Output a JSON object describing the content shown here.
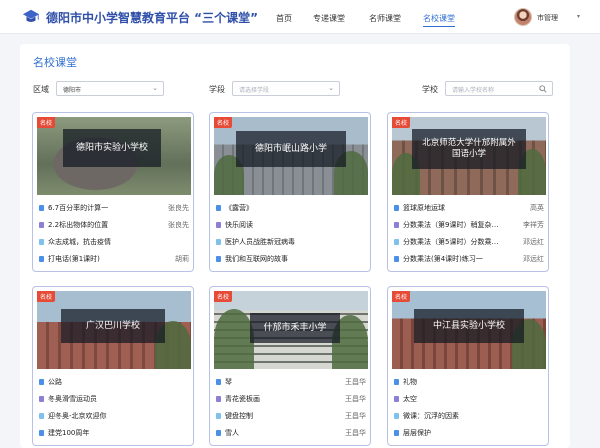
{
  "header": {
    "brand": "德阳市中小学智慧教育平台 “三个课堂”",
    "nav": [
      {
        "label": "首页",
        "active": false
      },
      {
        "label": "专递课堂",
        "active": false
      },
      {
        "label": "名师课堂",
        "active": false
      },
      {
        "label": "名校课堂",
        "active": true
      }
    ],
    "user": "市管理",
    "brand_color": "#2f4fa8",
    "accent_color": "#2f6fd0"
  },
  "page": {
    "title": "名校课堂",
    "filters": {
      "region_label": "区域",
      "region_value": "德阳市",
      "stage_label": "学段",
      "stage_placeholder": "请选择学段",
      "school_label": "学校",
      "school_placeholder": "请输入学校名称"
    }
  },
  "cards": [
    {
      "tag": "名校",
      "school": "德阳市实验小学校",
      "lessons": [
        {
          "title": "6.7百分率的计算一",
          "author": "张良先",
          "bullet": "blue"
        },
        {
          "title": "2.2标出物体的位置",
          "author": "张良先",
          "bullet": "purple"
        },
        {
          "title": "众志成城，抗击疫情",
          "author": "",
          "bullet": "cyan"
        },
        {
          "title": "打电话(第1课时)",
          "author": "胡莉",
          "bullet": "blue"
        }
      ]
    },
    {
      "tag": "名校",
      "school": "德阳市岷山路小学",
      "lessons": [
        {
          "title": "《露营》",
          "author": "",
          "bullet": "blue"
        },
        {
          "title": "快乐阅读",
          "author": "",
          "bullet": "purple"
        },
        {
          "title": "医护人员战胜新冠病毒",
          "author": "",
          "bullet": "cyan"
        },
        {
          "title": "我们和互联网的故事",
          "author": "",
          "bullet": "blue"
        }
      ]
    },
    {
      "tag": "名校",
      "school_line1": "北京师范大学什邡附属外",
      "school_line2": "国语小学",
      "lessons": [
        {
          "title": "篮球原地运球",
          "author": "高英",
          "bullet": "blue"
        },
        {
          "title": "分数乘法（第9课时）稍复杂…",
          "author": "李祥芳",
          "bullet": "purple"
        },
        {
          "title": "分数乘法（第5课时）分数乘…",
          "author": "邓远红",
          "bullet": "cyan"
        },
        {
          "title": "分数乘法(第4课时)练习一",
          "author": "邓远红",
          "bullet": "blue"
        }
      ]
    },
    {
      "tag": "名校",
      "school": "广汉巴川学校",
      "lessons": [
        {
          "title": "公路",
          "author": "",
          "bullet": "blue"
        },
        {
          "title": "冬奥滑雪运动员",
          "author": "",
          "bullet": "purple"
        },
        {
          "title": "迎冬奥-北京欢迎你",
          "author": "",
          "bullet": "cyan"
        },
        {
          "title": "建党100周年",
          "author": "",
          "bullet": "blue"
        }
      ]
    },
    {
      "tag": "名校",
      "school": "什邡市禾丰小学",
      "lessons": [
        {
          "title": "琴",
          "author": "王昌华",
          "bullet": "blue"
        },
        {
          "title": "青花瓷板画",
          "author": "王昌华",
          "bullet": "purple"
        },
        {
          "title": "键盘控制",
          "author": "王昌华",
          "bullet": "cyan"
        },
        {
          "title": "雪人",
          "author": "王昌华",
          "bullet": "blue"
        }
      ]
    },
    {
      "tag": "名校",
      "school": "中江县实验小学校",
      "lessons": [
        {
          "title": "礼物",
          "author": "",
          "bullet": "blue"
        },
        {
          "title": "太空",
          "author": "",
          "bullet": "purple"
        },
        {
          "title": "微课：沉浮的因素",
          "author": "",
          "bullet": "cyan"
        },
        {
          "title": "层层保护",
          "author": "",
          "bullet": "blue"
        }
      ]
    }
  ]
}
